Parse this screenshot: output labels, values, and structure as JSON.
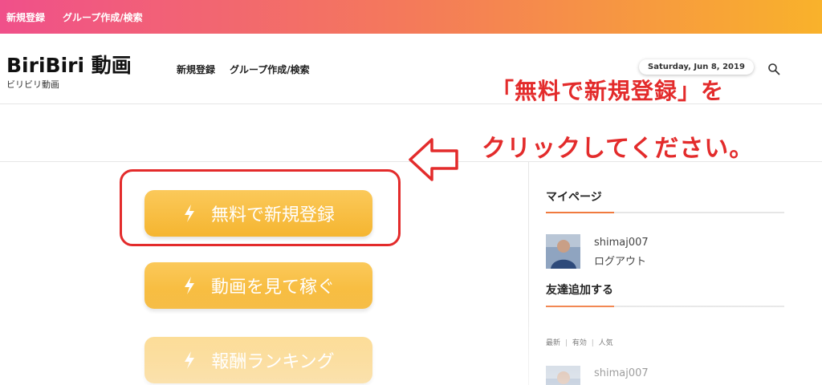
{
  "topbar": {
    "links": [
      "新規登録",
      "グループ作成/検索"
    ]
  },
  "header": {
    "site_title": "BiriBiri 動画",
    "tagline": "ビリビリ動画",
    "nav": [
      "新規登録",
      "グループ作成/検索"
    ],
    "date": "Saturday, Jun 8, 2019",
    "search_icon": "search-icon"
  },
  "annotation": {
    "line1": "「無料で新規登録」を",
    "line2": "クリックしてください。",
    "color": "#e32b2b",
    "arrow_icon": "left-arrow-icon"
  },
  "buttons": [
    {
      "label": "無料で新規登録",
      "icon": "lightning-bolt-icon"
    },
    {
      "label": "動画を見て稼ぐ",
      "icon": "lightning-bolt-icon"
    },
    {
      "label": "報酬ランキング",
      "icon": "lightning-bolt-icon"
    }
  ],
  "sidebar": {
    "mypage": {
      "title": "マイページ",
      "username": "shimaj007",
      "logout": "ログアウト"
    },
    "friends": {
      "title": "友達追加する",
      "filters": [
        "最新",
        "有効",
        "人気"
      ],
      "filter_separator": "|",
      "username": "shimaj007"
    }
  },
  "colors": {
    "accent": "#f07a3f",
    "button": "#f7bb3c",
    "topbar_start": "#f0508a",
    "topbar_end": "#f9b22b"
  }
}
